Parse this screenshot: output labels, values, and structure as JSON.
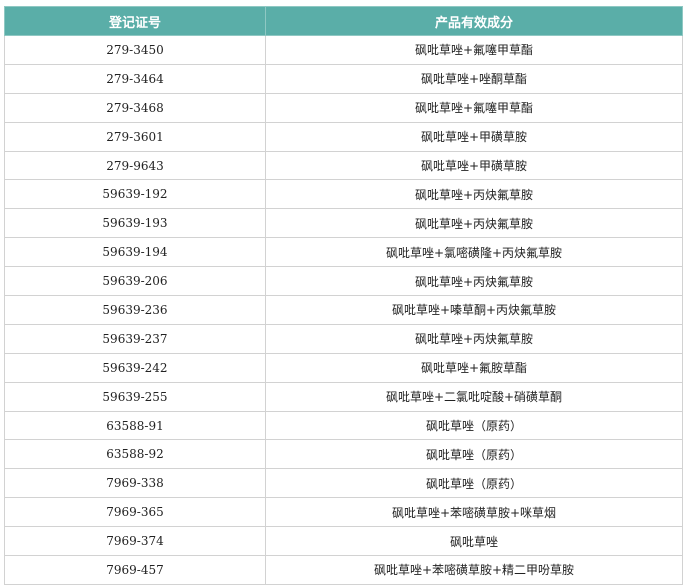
{
  "table": {
    "headers": [
      "登记证号",
      "产品有效成分"
    ],
    "rows": [
      {
        "reg": "279-3450",
        "ingredient": "砜吡草唑+氟噻甲草酯"
      },
      {
        "reg": "279-3464",
        "ingredient": "砜吡草唑+唑酮草酯"
      },
      {
        "reg": "279-3468",
        "ingredient": "砜吡草唑+氟噻甲草酯"
      },
      {
        "reg": "279-3601",
        "ingredient": "砜吡草唑+甲磺草胺"
      },
      {
        "reg": "279-9643",
        "ingredient": "砜吡草唑+甲磺草胺"
      },
      {
        "reg": "59639-192",
        "ingredient": "砜吡草唑+丙炔氟草胺"
      },
      {
        "reg": "59639-193",
        "ingredient": "砜吡草唑+丙炔氟草胺"
      },
      {
        "reg": "59639-194",
        "ingredient": "砜吡草唑+氯嘧磺隆+丙炔氟草胺"
      },
      {
        "reg": "59639-206",
        "ingredient": "砜吡草唑+丙炔氟草胺"
      },
      {
        "reg": "59639-236",
        "ingredient": "砜吡草唑+嗪草酮+丙炔氟草胺"
      },
      {
        "reg": "59639-237",
        "ingredient": "砜吡草唑+丙炔氟草胺"
      },
      {
        "reg": "59639-242",
        "ingredient": "砜吡草唑+氟胺草酯"
      },
      {
        "reg": "59639-255",
        "ingredient": "砜吡草唑+二氯吡啶酸+硝磺草酮"
      },
      {
        "reg": "63588-91",
        "ingredient": "砜吡草唑（原药）"
      },
      {
        "reg": "63588-92",
        "ingredient": "砜吡草唑（原药）"
      },
      {
        "reg": "7969-338",
        "ingredient": "砜吡草唑（原药）"
      },
      {
        "reg": "7969-365",
        "ingredient": "砜吡草唑+苯嘧磺草胺+咪草烟"
      },
      {
        "reg": "7969-374",
        "ingredient": "砜吡草唑"
      },
      {
        "reg": "7969-457",
        "ingredient": "砜吡草唑+苯嘧磺草胺+精二甲吩草胺"
      }
    ]
  }
}
